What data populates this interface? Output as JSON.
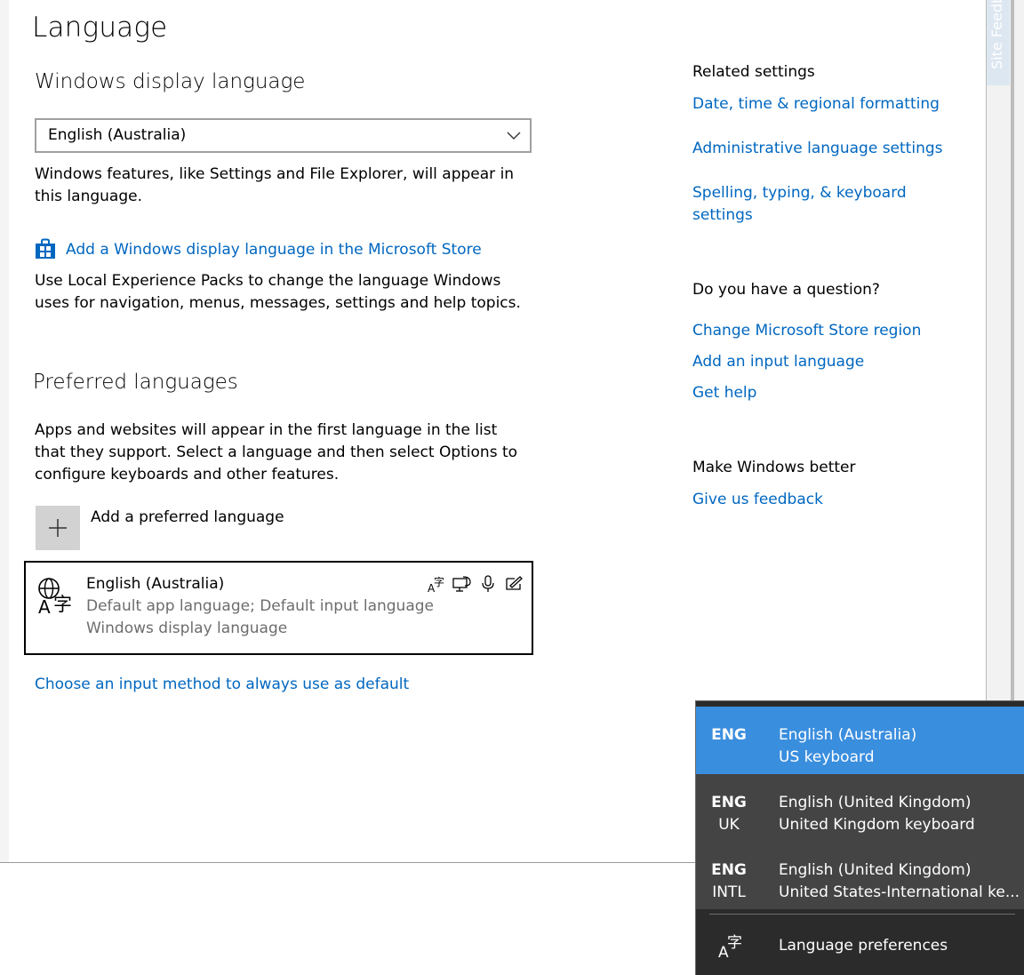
{
  "page": {
    "title": "Language",
    "site_feedback": "Site Feedback"
  },
  "display_language": {
    "heading": "Windows display language",
    "selected": "English (Australia)",
    "description": "Windows features, like Settings and File Explorer, will appear in this language.",
    "store_link": "Add a Windows display language in the Microsoft Store",
    "store_description": "Use Local Experience Packs to change the language Windows uses for navigation, menus, messages, settings and help topics."
  },
  "preferred": {
    "heading": "Preferred languages",
    "description": "Apps and websites will appear in the first language in the list that they support. Select a language and then select Options to configure keyboards and other features.",
    "add_label": "Add a preferred language",
    "language": {
      "name": "English (Australia)",
      "line1": "Default app language; Default input language",
      "line2": "Windows display language"
    },
    "default_input_link": "Choose an input method to always use as default"
  },
  "related": {
    "heading": "Related settings",
    "links": [
      "Date, time & regional formatting",
      "Administrative language settings",
      "Spelling, typing, & keyboard settings"
    ]
  },
  "question": {
    "heading": "Do you have a question?",
    "links": [
      "Change Microsoft Store region",
      "Add an input language",
      "Get help"
    ]
  },
  "better": {
    "heading": "Make Windows better",
    "link": "Give us feedback"
  },
  "flyout": {
    "items": [
      {
        "code1": "ENG",
        "code2": "",
        "name": "English (Australia)",
        "keyboard": "US keyboard"
      },
      {
        "code1": "ENG",
        "code2": "UK",
        "name": "English (United Kingdom)",
        "keyboard": "United Kingdom keyboard"
      },
      {
        "code1": "ENG",
        "code2": "INTL",
        "name": "English (United Kingdom)",
        "keyboard": "United States-International ke..."
      }
    ],
    "preferences": "Language preferences"
  },
  "colors": {
    "link": "#0067c0",
    "flyout_bg": "#2b2b2b",
    "flyout_selected": "#3a8ede"
  }
}
